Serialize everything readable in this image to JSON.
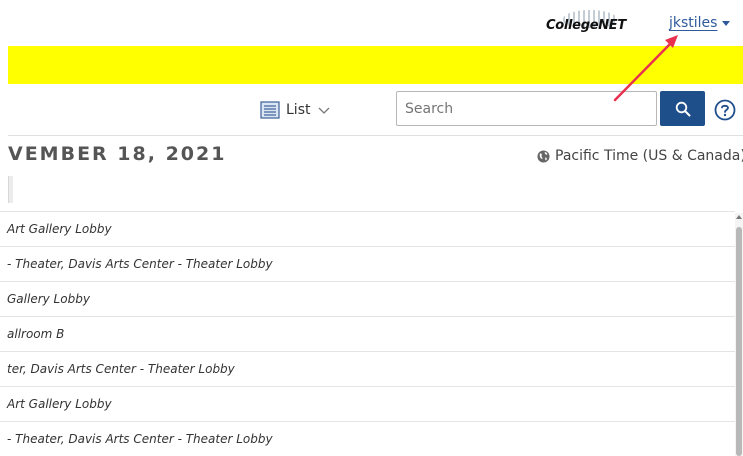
{
  "header": {
    "brand_name": "CollegeNET",
    "username": "jkstiles"
  },
  "toolbar": {
    "view_label": "List",
    "search_placeholder": "Search"
  },
  "schedule": {
    "date_heading": "VEMBER 18, 2021",
    "timezone": "Pacific Time (US & Canada)"
  },
  "events": [
    {
      "location": "Art Gallery Lobby"
    },
    {
      "location": "- Theater, Davis Arts Center - Theater Lobby"
    },
    {
      "location": "Gallery Lobby"
    },
    {
      "location": "allroom B"
    },
    {
      "location": "ter, Davis Arts Center - Theater Lobby"
    },
    {
      "location": "Art Gallery Lobby"
    },
    {
      "location": "- Theater, Davis Arts Center - Theater Lobby"
    }
  ],
  "colors": {
    "banner": "#ffff00",
    "accent": "#1f4f8b",
    "link": "#2e5a9c",
    "annotation_arrow": "#e8314f"
  },
  "icons": [
    "list-icon",
    "chevron-down-icon",
    "search-icon",
    "help-icon",
    "globe-icon",
    "caret-down-icon"
  ]
}
